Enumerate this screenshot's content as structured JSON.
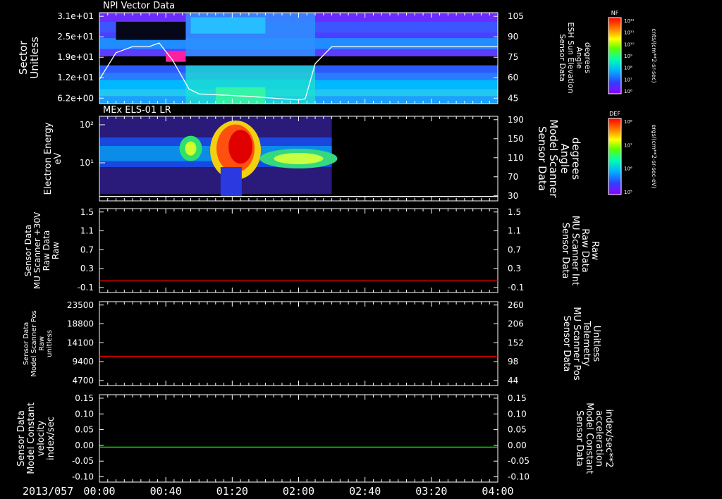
{
  "chart_data": [
    {
      "type": "heatmap",
      "title": "NPI Vector Data",
      "ylabel": [
        "Sector",
        "Unitless"
      ],
      "ytick_labels": [
        "3.1e+01",
        "2.5e+01",
        "1.9e+01",
        "1.2e+01",
        "6.2e+00"
      ],
      "ytick_values": [
        31,
        25,
        19,
        12,
        6.2
      ],
      "ylim": [
        0,
        31
      ],
      "right_axis": {
        "label": [
          "Sensor Data",
          "ESH Sun Elevation",
          "Angle",
          "degrees"
        ],
        "ticks": [
          105,
          90,
          75,
          60,
          45
        ],
        "ylim": [
          30,
          105
        ],
        "color": "#ffffff"
      },
      "overlay_line": {
        "x": [
          "00:00",
          "00:10",
          "00:20",
          "00:30",
          "00:36",
          "00:44",
          "00:54",
          "01:00",
          "01:30",
          "02:00",
          "02:04",
          "02:10",
          "02:20",
          "04:00"
        ],
        "y": [
          50,
          72,
          77,
          77,
          80,
          66,
          42,
          38,
          36,
          33,
          34,
          63,
          77,
          77
        ]
      },
      "colorbar": {
        "label": "NF",
        "unit": "cnts/(cm**2-sr-sec)",
        "ticks": [
          "10¹²",
          "10¹¹",
          "10¹⁰",
          "10⁹",
          "10⁸",
          "10⁷",
          "10⁶"
        ]
      }
    },
    {
      "type": "heatmap",
      "title": "MEx ELS-01 LR",
      "ylabel": [
        "Electron Energy",
        "eV"
      ],
      "ytick_labels": [
        "10²",
        "10¹"
      ],
      "ytick_values": [
        100,
        10
      ],
      "yscale": "log",
      "right_axis": {
        "label": [
          "Sensor Data",
          "Model Scanner",
          "Angle",
          "degrees"
        ],
        "ticks": [
          190,
          150,
          110,
          70,
          30
        ],
        "ylim": [
          0,
          190
        ],
        "color": "#ffffff"
      },
      "overlay_line": {
        "x": [
          "00:00",
          "04:00"
        ],
        "y": [
          10,
          10
        ]
      },
      "colorbar": {
        "label": "DEF",
        "unit": "ergs/(cm**2-sr-sec-eV)",
        "ticks": [
          "10⁸",
          "10⁷",
          "10⁶",
          "10⁵"
        ]
      }
    },
    {
      "type": "line",
      "ylabel": [
        "Sensor Data",
        "MU Scanner +30V",
        "Raw Data",
        "Raw"
      ],
      "ytick_labels": [
        "1.5",
        "1.1",
        "0.7",
        "0.3",
        "-0.1"
      ],
      "ylim": [
        -0.3,
        1.5
      ],
      "series": [
        {
          "color": "#ff0000",
          "x": [
            "00:00",
            "04:00"
          ],
          "y": [
            -0.05,
            -0.05
          ]
        }
      ],
      "right_axis": {
        "label": [
          "Sensor Data",
          "MU Scanner Int",
          "Raw Data",
          "Raw"
        ],
        "ticks": [
          "1.5",
          "1.1",
          "0.7",
          "0.3",
          "-0.1"
        ],
        "color": "#ff0000"
      }
    },
    {
      "type": "line",
      "ylabel": [
        "Sensor Data",
        "Model Scanner Pos",
        "Raw",
        "unitless"
      ],
      "ytick_labels": [
        "23500",
        "18800",
        "14100",
        "9400",
        "4700"
      ],
      "ylim": [
        0,
        23500
      ],
      "series": [
        {
          "color": "#ff0000",
          "x": [
            "00:00",
            "04:00"
          ],
          "y": [
            8200,
            8200
          ]
        }
      ],
      "right_axis": {
        "label": [
          "Sensor Data",
          "MU Scanner Pos",
          "Telemetry",
          "Unitless"
        ],
        "ticks": [
          "260",
          "206",
          "152",
          "98",
          "44"
        ],
        "color": "#ff0000"
      }
    },
    {
      "type": "line",
      "ylabel": [
        "Sensor Data",
        "Model Constant",
        "velocity",
        "index/sec"
      ],
      "ytick_labels": [
        "0.15",
        "0.10",
        "0.05",
        "0.00",
        "-0.05",
        "-0.10"
      ],
      "ylim": [
        -0.1,
        0.15
      ],
      "series": [
        {
          "color": "#00ff00",
          "x": [
            "00:00",
            "04:00"
          ],
          "y": [
            0,
            0
          ]
        }
      ],
      "right_axis": {
        "label": [
          "Sensor Data",
          "Model Constant",
          "acceleration",
          "index/sec**2"
        ],
        "ticks": [
          "0.15",
          "0.10",
          "0.05",
          "0.00",
          "-0.05",
          "-0.10"
        ],
        "color": "#00ff00"
      }
    }
  ],
  "x_axis": {
    "date": "2013/057",
    "ticks": [
      "00:00",
      "00:40",
      "01:20",
      "02:00",
      "02:40",
      "03:20",
      "04:00"
    ]
  }
}
